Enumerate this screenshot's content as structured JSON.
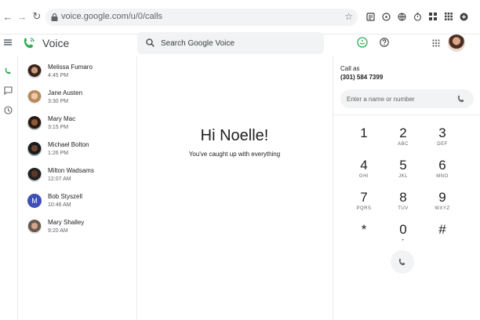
{
  "browser": {
    "url": "voice.google.com/u/0/calls",
    "back_icon": "arrow-left-icon",
    "forward_icon": "arrow-right-icon",
    "reload_icon": "reload-icon",
    "bookmark_icon": "star-icon"
  },
  "app": {
    "name": "Voice",
    "brand_color": "#34a853",
    "search_placeholder": "Search Google Voice"
  },
  "contacts": [
    {
      "name": "Melissa Fumaro",
      "time": "4:45 PM"
    },
    {
      "name": "Jane Austen",
      "time": "3:30 PM"
    },
    {
      "name": "Mary Mac",
      "time": "3:15 PM"
    },
    {
      "name": "Michael Bolton",
      "time": "1:26 PM"
    },
    {
      "name": "Milton Wadsams",
      "time": "12:07 AM"
    },
    {
      "name": "Bob Styszell",
      "time": "10:46 AM",
      "initial": "M"
    },
    {
      "name": "Mary Shalley",
      "time": "9:20 AM"
    }
  ],
  "main": {
    "greeting": "Hi Noelle!",
    "subtitle": "You've caught up with everything"
  },
  "dialer": {
    "call_as_label": "Call as",
    "call_as_number": "(301) 584 7399",
    "input_placeholder": "Enter a name or number",
    "keys": [
      {
        "digit": "1",
        "letters": ""
      },
      {
        "digit": "2",
        "letters": "ABC"
      },
      {
        "digit": "3",
        "letters": "DEF"
      },
      {
        "digit": "4",
        "letters": "GHI"
      },
      {
        "digit": "5",
        "letters": "JKL"
      },
      {
        "digit": "6",
        "letters": "MNO"
      },
      {
        "digit": "7",
        "letters": "PQRS"
      },
      {
        "digit": "8",
        "letters": "TUV"
      },
      {
        "digit": "9",
        "letters": "WXYZ"
      },
      {
        "digit": "*",
        "letters": ""
      },
      {
        "digit": "0",
        "letters": "+"
      },
      {
        "digit": "#",
        "letters": ""
      }
    ]
  }
}
